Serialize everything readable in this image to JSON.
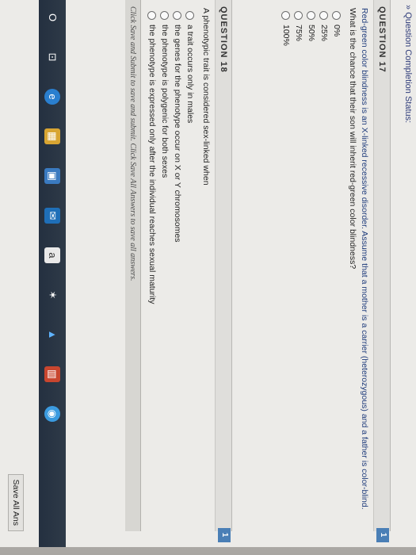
{
  "status": {
    "label": "Question Completion Status:"
  },
  "q17": {
    "header": "QUESTION 17",
    "points": "1",
    "text_line1": "Red-green color blindness is an X-linked recessive disorder. Assume that a mother is a carrier (heterozygous) and a father is color-blind.",
    "text_line2": "What is the chance that their son will inherit red-green color blindness?",
    "options": [
      "0%",
      "25%",
      "50%",
      "75%",
      "100%"
    ]
  },
  "q18": {
    "header": "QUESTION 18",
    "points": "1",
    "text": "A phenotypic trait is considered sex-linked when",
    "options": [
      "a trait occurs only in males",
      "the genes for the phenotype occur on X or Y chromosomes",
      "the phenotype is polygenic for both sexes",
      "the phenotype is expressed only after the individual reaches sexual maturity"
    ]
  },
  "footer": {
    "text": "Click Save and Submit to save and submit. Click Save All Answers to save all answers."
  },
  "save_all": {
    "label": "Save All Ans"
  },
  "taskbar": {
    "icons": [
      "O",
      "⊡",
      "e",
      "▦",
      "▣",
      "✉",
      "a",
      "✶",
      "▲",
      "▥",
      "◉"
    ]
  },
  "colors": {
    "accent": "#4a7fb6",
    "taskbar": "#2b3644"
  }
}
